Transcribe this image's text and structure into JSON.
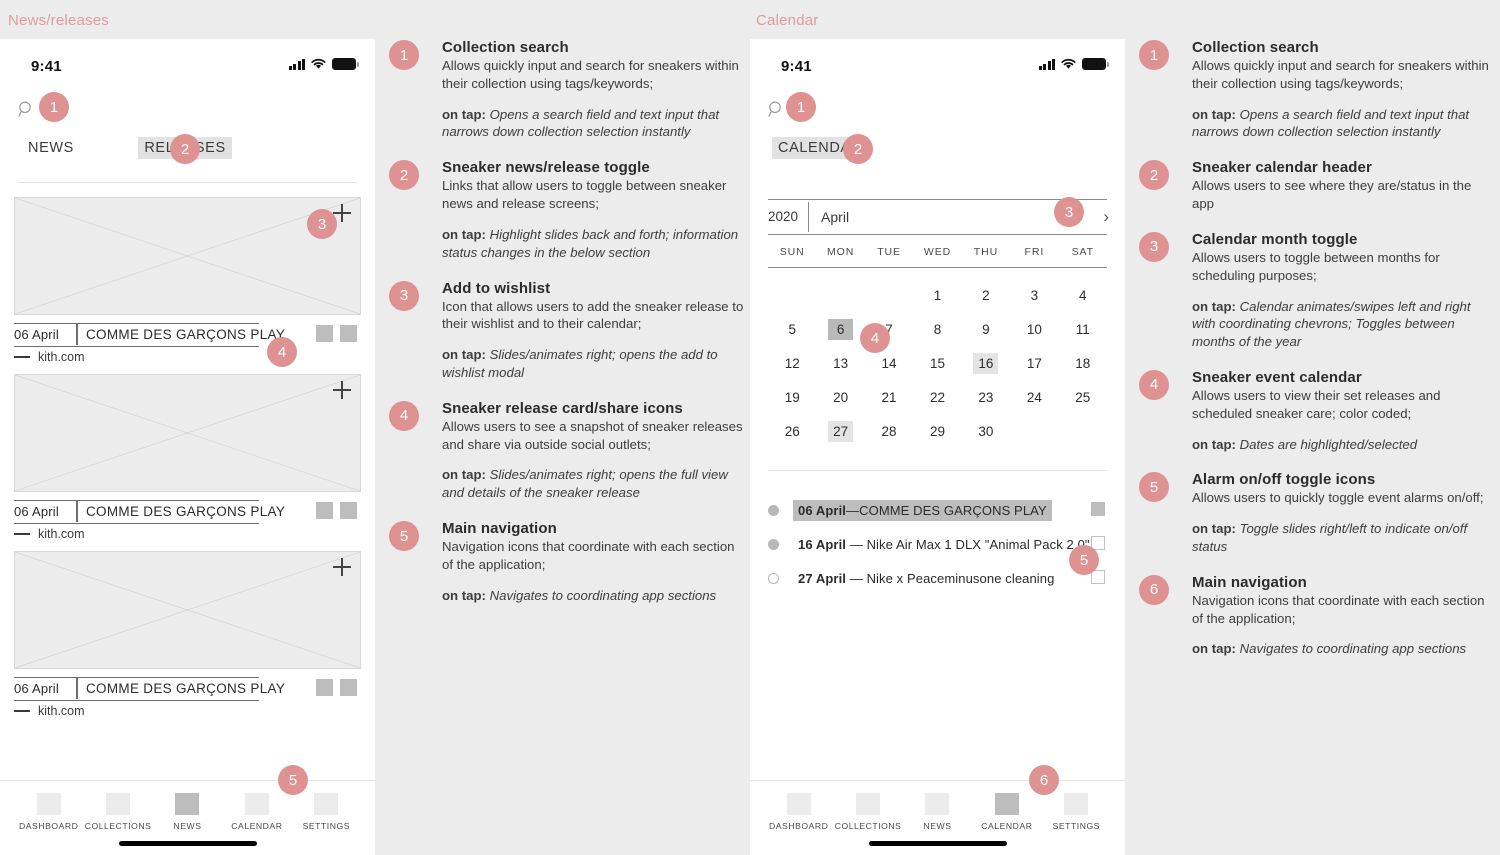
{
  "sections": {
    "left_title": "News/releases",
    "right_title": "Calendar"
  },
  "status_bar": {
    "time": "9:41"
  },
  "left_screen": {
    "tabs": [
      {
        "label": "NEWS",
        "active": false
      },
      {
        "label": "RELEASES",
        "active": true
      }
    ],
    "cards": [
      {
        "date": "06 April",
        "title": "COMME DES GARÇONS PLAY",
        "source": "kith.com"
      },
      {
        "date": "06 April",
        "title": "COMME DES GARÇONS PLAY",
        "source": "kith.com"
      },
      {
        "date": "06 April",
        "title": "COMME DES GARÇONS PLAY",
        "source": "kith.com"
      }
    ],
    "markers": [
      "1",
      "2",
      "3",
      "4",
      "5"
    ],
    "nav": [
      {
        "label": "DASHBOARD",
        "active": false
      },
      {
        "label": "COLLECTIONS",
        "active": false
      },
      {
        "label": "NEWS",
        "active": true
      },
      {
        "label": "CALENDAR",
        "active": false
      },
      {
        "label": "SETTINGS",
        "active": false
      }
    ]
  },
  "right_screen": {
    "tabs": [
      {
        "label": "CALENDAR",
        "active": true
      }
    ],
    "calendar": {
      "year": "2020",
      "month": "April",
      "next_chevron": "›",
      "weekdays": [
        "SUN",
        "MON",
        "TUE",
        "WED",
        "THU",
        "FRI",
        "SAT"
      ],
      "leading_blanks": 3,
      "days": [
        1,
        2,
        3,
        4,
        5,
        6,
        7,
        8,
        9,
        10,
        11,
        12,
        13,
        14,
        15,
        16,
        17,
        18,
        19,
        20,
        21,
        22,
        23,
        24,
        25,
        26,
        27,
        28,
        29,
        30
      ],
      "highlight_strong": [
        6
      ],
      "highlight_light": [
        16,
        27
      ]
    },
    "events": [
      {
        "date": "06 April",
        "dash": "—",
        "name": "COMME DES GARÇONS PLAY",
        "dot": "filled",
        "selected": true,
        "toggle": "on"
      },
      {
        "date": "16 April",
        "dash": "—",
        "name": "Nike Air Max 1 DLX \"Animal Pack 2.0\"",
        "dot": "filled",
        "selected": false,
        "toggle": "off"
      },
      {
        "date": "27 April",
        "dash": "—",
        "name": "Nike x Peaceminusone cleaning",
        "dot": "hollow",
        "selected": false,
        "toggle": "off"
      }
    ],
    "markers": [
      "1",
      "2",
      "3",
      "4",
      "5",
      "6"
    ],
    "nav": [
      {
        "label": "DASHBOARD",
        "active": false
      },
      {
        "label": "COLLECTIONS",
        "active": false
      },
      {
        "label": "NEWS",
        "active": false
      },
      {
        "label": "CALENDAR",
        "active": true
      },
      {
        "label": "SETTINGS",
        "active": false
      }
    ]
  },
  "notes_left": [
    {
      "num": "1",
      "title": "Collection search",
      "desc": "Allows quickly input and search for sneakers within their collection using tags/keywords;",
      "tap_label": "on tap:",
      "tap": " Opens a search field and text input that narrows down collection selection instantly"
    },
    {
      "num": "2",
      "title": "Sneaker news/release toggle",
      "desc": "Links that allow users to toggle between sneaker news and release screens;",
      "tap_label": "on tap:",
      "tap": " Highlight slides back and forth; information status changes in the below section"
    },
    {
      "num": "3",
      "title": "Add to wishlist",
      "desc": "Icon that allows users to add the sneaker release to their wishlist and to their calendar;",
      "tap_label": "on tap:",
      "tap": " Slides/animates right; opens the add to wishlist modal"
    },
    {
      "num": "4",
      "title": "Sneaker release card/share icons",
      "desc": "Allows users to see a snapshot of sneaker releases and share via outside social outlets;",
      "tap_label": "on tap:",
      "tap": " Slides/animates right; opens the full view and details of the sneaker release"
    },
    {
      "num": "5",
      "title": "Main navigation",
      "desc": "Navigation icons that coordinate with each section of the application;",
      "tap_label": "on tap:",
      "tap": " Navigates to coordinating app sections"
    }
  ],
  "notes_right": [
    {
      "num": "1",
      "title": "Collection search",
      "desc": "Allows quickly input and search for sneakers within their collection using tags/keywords;",
      "tap_label": "on tap:",
      "tap": " Opens a search field and text input that narrows down collection selection instantly"
    },
    {
      "num": "2",
      "title": "Sneaker calendar header",
      "desc": "Allows users to see where they are/status in the app",
      "tap_label": "",
      "tap": ""
    },
    {
      "num": "3",
      "title": "Calendar month toggle",
      "desc": "Allows users to toggle between months for scheduling purposes;",
      "tap_label": "on tap:",
      "tap": " Calendar animates/swipes left and right with coordinating chevrons; Toggles between months of the year"
    },
    {
      "num": "4",
      "title": "Sneaker event calendar",
      "desc": "Allows users to view their set releases and scheduled sneaker care; color coded;",
      "tap_label": "on tap:",
      "tap": " Dates are highlighted/selected"
    },
    {
      "num": "5",
      "title": "Alarm on/off toggle icons",
      "desc": "Allows users to quickly toggle event alarms on/off;",
      "tap_label": "on tap:",
      "tap": " Toggle slides right/left to indicate on/off status"
    },
    {
      "num": "6",
      "title": "Main navigation",
      "desc": "Navigation icons that coordinate with each section of the application;",
      "tap_label": "on tap:",
      "tap": " Navigates to coordinating app sections"
    }
  ],
  "colors": {
    "accent": "#de9292",
    "page_bg": "#ececec",
    "phone_bg": "#ffffff",
    "highlight_strong": "#b9b9b9",
    "highlight_light": "#e4e4e4"
  }
}
